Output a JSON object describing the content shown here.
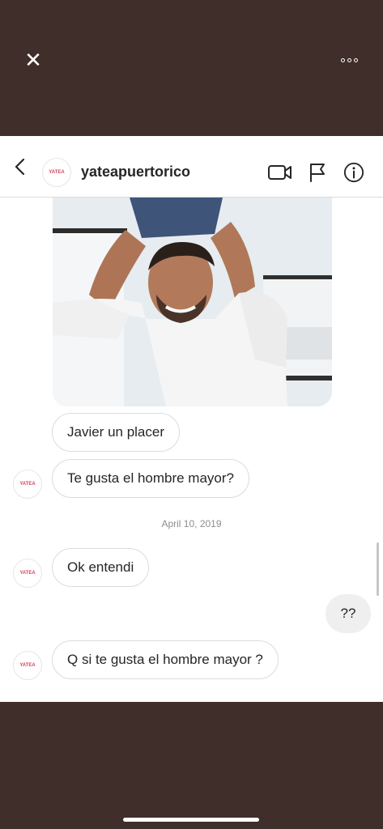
{
  "overlay": {
    "close_icon": "close-icon",
    "more_icon": "more-options-icon"
  },
  "header": {
    "back_icon": "chevron-left-icon",
    "avatar_text": "YATEA",
    "username": "yateapuertorico",
    "video_icon": "video-call-icon",
    "flag_icon": "flag-icon",
    "info_icon": "info-icon"
  },
  "messages": [
    {
      "type": "incoming",
      "text": "Javier un placer",
      "avatar": false
    },
    {
      "type": "incoming",
      "text": "Te gusta el hombre mayor?",
      "avatar": true,
      "avatar_text": "YATEA"
    },
    {
      "type": "date",
      "text": "April 10, 2019"
    },
    {
      "type": "incoming",
      "text": "Ok entendi",
      "avatar": true,
      "avatar_text": "YATEA"
    },
    {
      "type": "outgoing",
      "text": "??"
    },
    {
      "type": "incoming",
      "text": "Q si te gusta el hombre mayor ?",
      "avatar": true,
      "avatar_text": "YATEA"
    }
  ],
  "colors": {
    "backdrop": "#3f2e2a",
    "brand_logo": "#d5455c",
    "bubble_border": "#dbdbdb",
    "own_bubble": "#efefef"
  }
}
